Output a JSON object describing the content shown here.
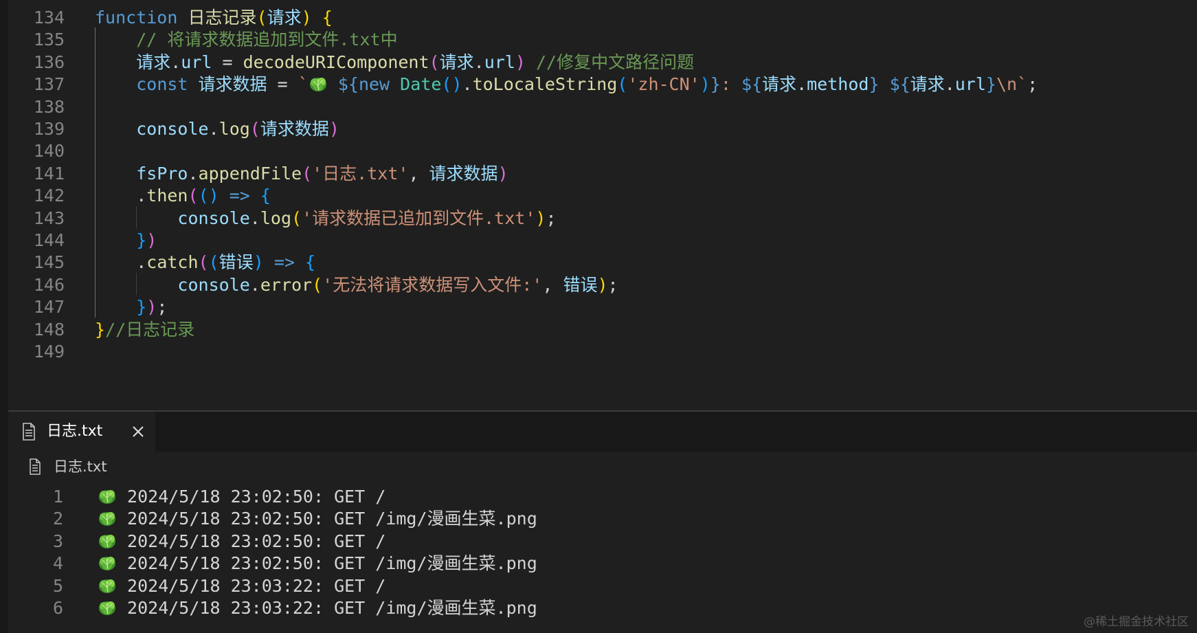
{
  "editor": {
    "lines": [
      {
        "num": "134",
        "tokens": [
          {
            "t": "function",
            "c": "kw"
          },
          {
            "t": " ",
            "c": "tx"
          },
          {
            "t": "日志记录",
            "c": "fn"
          },
          {
            "t": "(",
            "c": "b1"
          },
          {
            "t": "请求",
            "c": "vr"
          },
          {
            "t": ")",
            "c": "b1"
          },
          {
            "t": " ",
            "c": "tx"
          },
          {
            "t": "{",
            "c": "b1"
          }
        ]
      },
      {
        "num": "135",
        "tokens": [
          {
            "t": "    ",
            "c": "tx"
          },
          {
            "t": "// 将请求数据追加到文件.txt中",
            "c": "cm"
          }
        ]
      },
      {
        "num": "136",
        "tokens": [
          {
            "t": "    ",
            "c": "tx"
          },
          {
            "t": "请求",
            "c": "vr"
          },
          {
            "t": ".",
            "c": "tx"
          },
          {
            "t": "url",
            "c": "vr"
          },
          {
            "t": " = ",
            "c": "tx"
          },
          {
            "t": "decodeURIComponent",
            "c": "fn"
          },
          {
            "t": "(",
            "c": "b2"
          },
          {
            "t": "请求",
            "c": "vr"
          },
          {
            "t": ".",
            "c": "tx"
          },
          {
            "t": "url",
            "c": "vr"
          },
          {
            "t": ")",
            "c": "b2"
          },
          {
            "t": " ",
            "c": "tx"
          },
          {
            "t": "//修复中文路径问题",
            "c": "cm"
          }
        ]
      },
      {
        "num": "137",
        "tokens": [
          {
            "t": "    ",
            "c": "tx"
          },
          {
            "t": "const",
            "c": "kw"
          },
          {
            "t": " ",
            "c": "tx"
          },
          {
            "t": "请求数据",
            "c": "vr"
          },
          {
            "t": " = ",
            "c": "tx"
          },
          {
            "t": "`",
            "c": "st"
          },
          {
            "t": "",
            "c": "emoji"
          },
          {
            "t": " ",
            "c": "st"
          },
          {
            "t": "${",
            "c": "kw"
          },
          {
            "t": "new",
            "c": "kw"
          },
          {
            "t": " ",
            "c": "tx"
          },
          {
            "t": "Date",
            "c": "tp"
          },
          {
            "t": "()",
            "c": "b3"
          },
          {
            "t": ".",
            "c": "tx"
          },
          {
            "t": "toLocaleString",
            "c": "fn"
          },
          {
            "t": "(",
            "c": "b3"
          },
          {
            "t": "'zh-CN'",
            "c": "st"
          },
          {
            "t": ")",
            "c": "b3"
          },
          {
            "t": "}",
            "c": "kw"
          },
          {
            "t": ": ",
            "c": "st"
          },
          {
            "t": "${",
            "c": "kw"
          },
          {
            "t": "请求",
            "c": "vr"
          },
          {
            "t": ".",
            "c": "tx"
          },
          {
            "t": "method",
            "c": "vr"
          },
          {
            "t": "}",
            "c": "kw"
          },
          {
            "t": " ",
            "c": "st"
          },
          {
            "t": "${",
            "c": "kw"
          },
          {
            "t": "请求",
            "c": "vr"
          },
          {
            "t": ".",
            "c": "tx"
          },
          {
            "t": "url",
            "c": "vr"
          },
          {
            "t": "}",
            "c": "kw"
          },
          {
            "t": "\\n`",
            "c": "st"
          },
          {
            "t": ";",
            "c": "tx"
          }
        ]
      },
      {
        "num": "138",
        "tokens": []
      },
      {
        "num": "139",
        "tokens": [
          {
            "t": "    ",
            "c": "tx"
          },
          {
            "t": "console",
            "c": "vr"
          },
          {
            "t": ".",
            "c": "tx"
          },
          {
            "t": "log",
            "c": "fn"
          },
          {
            "t": "(",
            "c": "b2"
          },
          {
            "t": "请求数据",
            "c": "vr"
          },
          {
            "t": ")",
            "c": "b2"
          }
        ]
      },
      {
        "num": "140",
        "tokens": []
      },
      {
        "num": "141",
        "tokens": [
          {
            "t": "    ",
            "c": "tx"
          },
          {
            "t": "fsPro",
            "c": "vr"
          },
          {
            "t": ".",
            "c": "tx"
          },
          {
            "t": "appendFile",
            "c": "fn"
          },
          {
            "t": "(",
            "c": "b2"
          },
          {
            "t": "'日志.txt'",
            "c": "st"
          },
          {
            "t": ", ",
            "c": "tx"
          },
          {
            "t": "请求数据",
            "c": "vr"
          },
          {
            "t": ")",
            "c": "b2"
          }
        ]
      },
      {
        "num": "142",
        "tokens": [
          {
            "t": "    ",
            "c": "tx"
          },
          {
            "t": ".",
            "c": "tx"
          },
          {
            "t": "then",
            "c": "fn"
          },
          {
            "t": "(",
            "c": "b2"
          },
          {
            "t": "()",
            "c": "b3"
          },
          {
            "t": " ",
            "c": "tx"
          },
          {
            "t": "=>",
            "c": "kw"
          },
          {
            "t": " ",
            "c": "tx"
          },
          {
            "t": "{",
            "c": "b3"
          }
        ]
      },
      {
        "num": "143",
        "tokens": [
          {
            "t": "        ",
            "c": "tx"
          },
          {
            "t": "console",
            "c": "vr"
          },
          {
            "t": ".",
            "c": "tx"
          },
          {
            "t": "log",
            "c": "fn"
          },
          {
            "t": "(",
            "c": "b1"
          },
          {
            "t": "'请求数据已追加到文件.txt'",
            "c": "st"
          },
          {
            "t": ")",
            "c": "b1"
          },
          {
            "t": ";",
            "c": "tx"
          }
        ]
      },
      {
        "num": "144",
        "tokens": [
          {
            "t": "    ",
            "c": "tx"
          },
          {
            "t": "}",
            "c": "b3"
          },
          {
            "t": ")",
            "c": "b2"
          }
        ]
      },
      {
        "num": "145",
        "tokens": [
          {
            "t": "    ",
            "c": "tx"
          },
          {
            "t": ".",
            "c": "tx"
          },
          {
            "t": "catch",
            "c": "fn"
          },
          {
            "t": "(",
            "c": "b2"
          },
          {
            "t": "(",
            "c": "b3"
          },
          {
            "t": "错误",
            "c": "vr"
          },
          {
            "t": ")",
            "c": "b3"
          },
          {
            "t": " ",
            "c": "tx"
          },
          {
            "t": "=>",
            "c": "kw"
          },
          {
            "t": " ",
            "c": "tx"
          },
          {
            "t": "{",
            "c": "b3"
          }
        ]
      },
      {
        "num": "146",
        "tokens": [
          {
            "t": "        ",
            "c": "tx"
          },
          {
            "t": "console",
            "c": "vr"
          },
          {
            "t": ".",
            "c": "tx"
          },
          {
            "t": "error",
            "c": "fn"
          },
          {
            "t": "(",
            "c": "b1"
          },
          {
            "t": "'无法将请求数据写入文件:'",
            "c": "st"
          },
          {
            "t": ", ",
            "c": "tx"
          },
          {
            "t": "错误",
            "c": "vr"
          },
          {
            "t": ")",
            "c": "b1"
          },
          {
            "t": ";",
            "c": "tx"
          }
        ]
      },
      {
        "num": "147",
        "tokens": [
          {
            "t": "    ",
            "c": "tx"
          },
          {
            "t": "}",
            "c": "b3"
          },
          {
            "t": ")",
            "c": "b2"
          },
          {
            "t": ";",
            "c": "tx"
          }
        ]
      },
      {
        "num": "148",
        "tokens": [
          {
            "t": "}",
            "c": "b1"
          },
          {
            "t": "//日志记录",
            "c": "cm"
          }
        ]
      },
      {
        "num": "149",
        "tokens": []
      }
    ]
  },
  "tab": {
    "label": "日志.txt",
    "file_icon": "file-lines-icon",
    "close_icon": "close-icon"
  },
  "breadcrumb": {
    "label": "日志.txt",
    "icon": "file-lines-icon"
  },
  "log": {
    "emoji_icon": "cabbage-emoji",
    "lines": [
      {
        "num": "1",
        "text": "2024/5/18 23:02:50: GET /"
      },
      {
        "num": "2",
        "text": "2024/5/18 23:02:50: GET /img/漫画生菜.png"
      },
      {
        "num": "3",
        "text": "2024/5/18 23:02:50: GET /"
      },
      {
        "num": "4",
        "text": "2024/5/18 23:02:50: GET /img/漫画生菜.png"
      },
      {
        "num": "5",
        "text": "2024/5/18 23:03:22: GET /"
      },
      {
        "num": "6",
        "text": "2024/5/18 23:03:22: GET /img/漫画生菜.png"
      }
    ]
  },
  "watermark": "@稀土掘金技术社区",
  "colors": {
    "background": "#1f1f1f",
    "keyword": "#569cd6",
    "function": "#dcdcaa",
    "variable": "#9cdcfe",
    "comment": "#6a9955",
    "string": "#ce9178"
  }
}
